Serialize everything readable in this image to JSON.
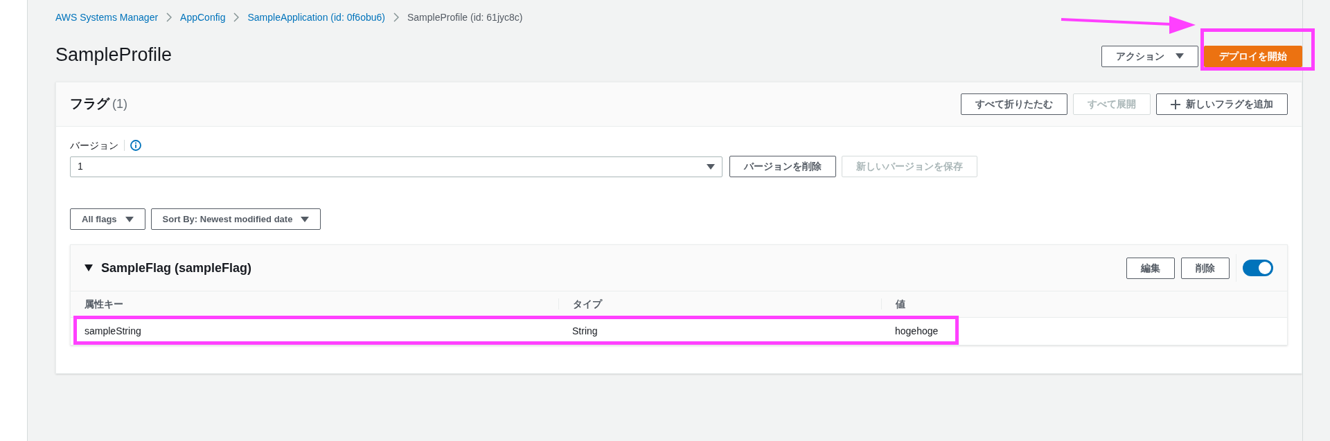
{
  "breadcrumbs": [
    {
      "label": "AWS Systems Manager",
      "link": true
    },
    {
      "label": "AppConfig",
      "link": true
    },
    {
      "label": "SampleApplication (id: 0f6obu6)",
      "link": true
    },
    {
      "label": "SampleProfile (id: 61jyc8c)",
      "link": false
    }
  ],
  "title": "SampleProfile",
  "header_actions": [
    {
      "label": "アクション",
      "kind": "dropdown"
    },
    {
      "label": "デプロイを開始",
      "kind": "primary"
    }
  ],
  "flags_panel": {
    "title": "フラグ",
    "count": "(1)",
    "buttons": [
      {
        "label": "すべて折りたたむ",
        "disabled": false,
        "kind": "plain"
      },
      {
        "label": "すべて展開",
        "disabled": true,
        "kind": "plain"
      },
      {
        "label": "新しいフラグを追加",
        "disabled": false,
        "kind": "add"
      }
    ],
    "version": {
      "label": "バージョン",
      "value": "1"
    },
    "version_buttons": [
      {
        "label": "バージョンを削除",
        "disabled": false
      },
      {
        "label": "新しいバージョンを保存",
        "disabled": true
      }
    ],
    "filters": [
      "All flags",
      "Sort By: Newest modified date"
    ],
    "flag": {
      "title": "SampleFlag (sampleFlag)",
      "expanded": true,
      "buttons": [
        "編集",
        "削除"
      ],
      "on": true,
      "columns": [
        "属性キー",
        "タイプ",
        "値"
      ],
      "rows": [
        [
          "sampleString",
          "String",
          "hogehoge"
        ]
      ]
    }
  }
}
